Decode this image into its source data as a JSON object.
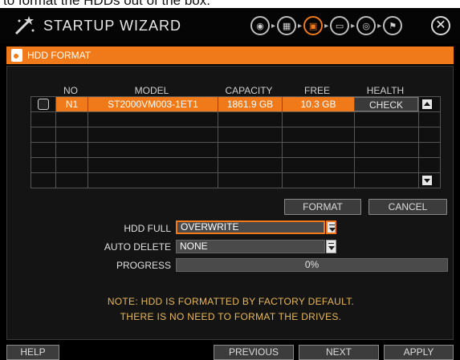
{
  "caption": "to format the HDDs out of the box.",
  "header": {
    "title": "STARTUP WIZARD",
    "steps": [
      {
        "icon": "globe-icon",
        "active": false,
        "glyph": "◉"
      },
      {
        "icon": "calendar-icon",
        "active": false,
        "glyph": "▦"
      },
      {
        "icon": "hdd-icon",
        "active": true,
        "glyph": "▣"
      },
      {
        "icon": "monitor-icon",
        "active": false,
        "glyph": "▭"
      },
      {
        "icon": "camera-icon",
        "active": false,
        "glyph": "◎"
      },
      {
        "icon": "finish-flag-icon",
        "active": false,
        "glyph": "⚑"
      }
    ],
    "close": "✕"
  },
  "section": {
    "title": "HDD FORMAT"
  },
  "table": {
    "columns": [
      "NO",
      "MODEL",
      "CAPACITY",
      "FREE",
      "HEALTH"
    ],
    "rows": [
      {
        "no": "N1",
        "model": "ST2000VM003-1ET1",
        "capacity": "1861.9 GB",
        "free": "10.3 GB",
        "health": "CHECK"
      }
    ]
  },
  "buttons": {
    "format": "FORMAT",
    "cancel": "CANCEL"
  },
  "form": {
    "hdd_full_label": "HDD FULL",
    "hdd_full_value": "OVERWRITE",
    "auto_delete_label": "AUTO DELETE",
    "auto_delete_value": "NONE",
    "progress_label": "PROGRESS",
    "progress_value": 0,
    "progress_text": "0%"
  },
  "note": {
    "line1": "NOTE: HDD IS FORMATTED BY FACTORY DEFAULT.",
    "line2": "THERE IS NO NEED TO FORMAT THE DRIVES."
  },
  "footer": {
    "help": "HELP",
    "previous": "PREVIOUS",
    "next": "NEXT",
    "apply": "APPLY"
  },
  "colors": {
    "accent": "#f07a1a",
    "background": "#000000",
    "note": "#e8b85a"
  }
}
